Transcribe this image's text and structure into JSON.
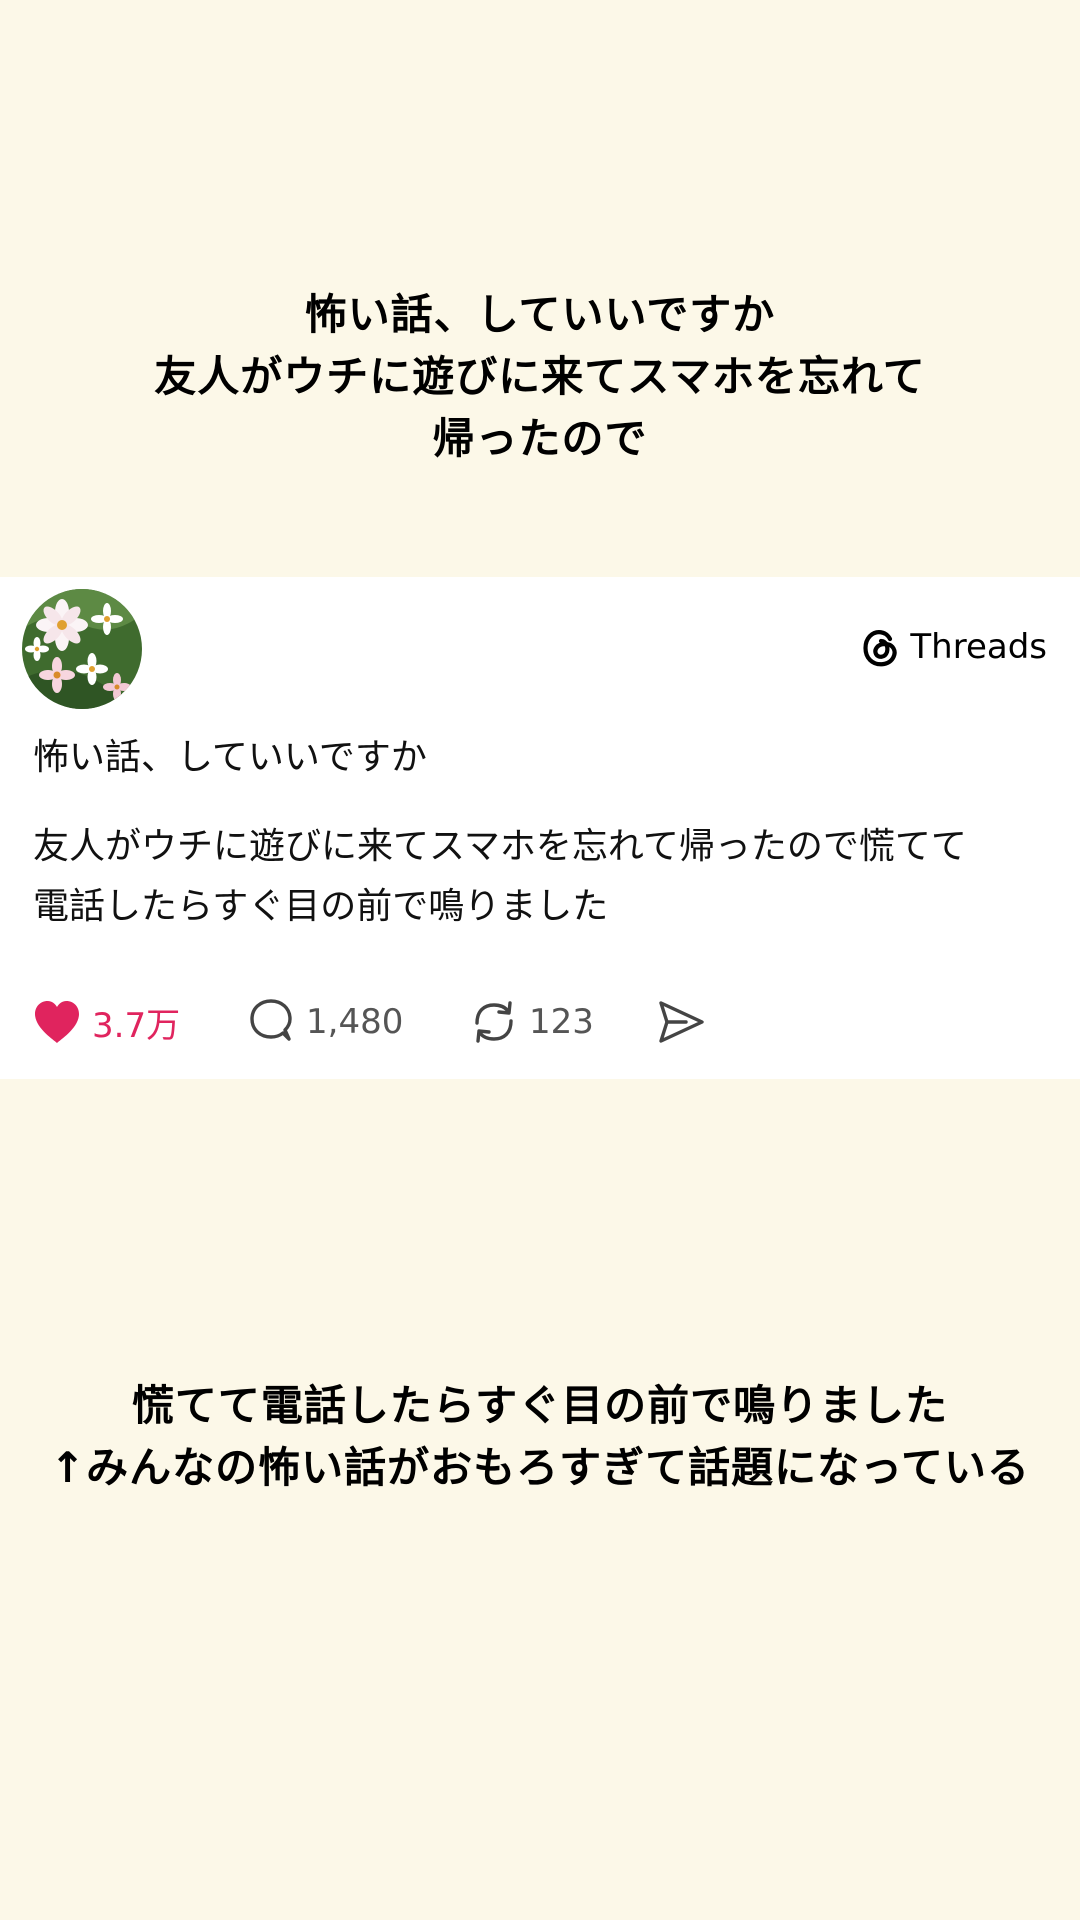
{
  "caption_top": {
    "lines": [
      "怖い話、していいですか",
      "友人がウチに遊びに来てスマホを忘れて",
      "帰ったので"
    ]
  },
  "card": {
    "brand_name": "Threads",
    "brand_icon": "threads-logo-icon",
    "avatar_icon": "flower-avatar",
    "post": {
      "title": "怖い話、していいですか",
      "body_lines": [
        "友人がウチに遊びに来てスマホを忘れて帰ったので慌てて",
        "電話したらすぐ目の前で鳴りました"
      ]
    },
    "actions": {
      "like_count": "3.7万",
      "reply_count": "1,480",
      "repost_count": "123"
    }
  },
  "caption_bottom": {
    "lines": [
      "慌てて電話したらすぐ目の前で鳴りました",
      "↑みんなの怖い話がおもろすぎて話題になっている"
    ]
  },
  "colors": {
    "background": "#fcf8e8",
    "card": "#ffffff",
    "like": "#e0245e",
    "text": "#111111"
  }
}
